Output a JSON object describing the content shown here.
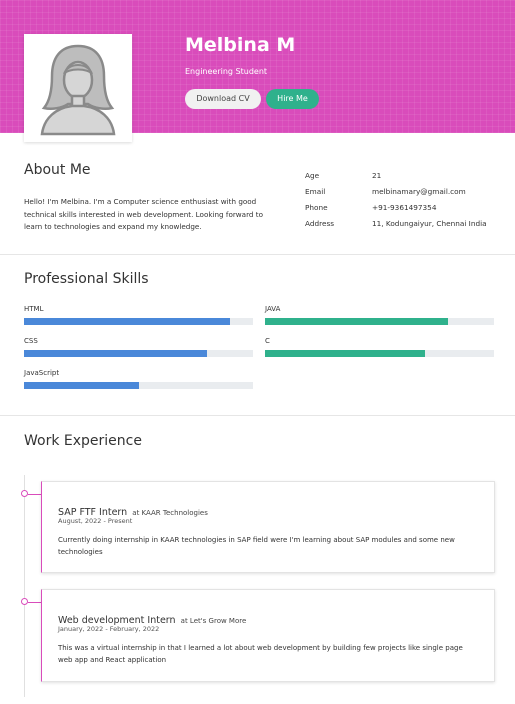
{
  "header": {
    "name": "Melbina M",
    "role": "Engineering Student",
    "download_cv_label": "Download CV",
    "hire_me_label": "Hire Me",
    "avatar_icon": "user-avatar-icon",
    "colors": {
      "banner": "#d94cbb",
      "hire_button": "#2fb18c"
    }
  },
  "about": {
    "title": "About Me",
    "text": "Hello! I'm Melbina. I'm a Computer science enthusiast with good technical skills interested in web development. Looking forward to learn to technologies and expand my knowledge.",
    "info": [
      {
        "label": "Age",
        "value": "21"
      },
      {
        "label": "Email",
        "value": "melbinamary@gmail.com"
      },
      {
        "label": "Phone",
        "value": "+91-9361497354"
      },
      {
        "label": "Address",
        "value": "11, Kodungaiyur, Chennai India"
      }
    ]
  },
  "skills": {
    "title": "Professional Skills",
    "items": [
      {
        "name": "HTML",
        "percent": 90,
        "color": "#4a88d9"
      },
      {
        "name": "JAVA",
        "percent": 80,
        "color": "#2fb18c"
      },
      {
        "name": "CSS",
        "percent": 80,
        "color": "#4a88d9"
      },
      {
        "name": "C",
        "percent": 70,
        "color": "#2fb18c"
      },
      {
        "name": "JavaScript",
        "percent": 50,
        "color": "#4a88d9"
      }
    ]
  },
  "experience": {
    "title": "Work Experience",
    "items": [
      {
        "role": "SAP FTF Intern",
        "company": "at KAAR Technologies",
        "dates": "August, 2022 - Present",
        "description": "Currently doing internship in KAAR technologies in SAP field were I'm learning about SAP modules and some new technologies"
      },
      {
        "role": "Web development Intern",
        "company": "at Let's Grow More",
        "dates": "January, 2022 - February, 2022",
        "description": "This was a virtual internship in that I learned a lot about web development by building few projects like single page web app and React application"
      }
    ]
  }
}
